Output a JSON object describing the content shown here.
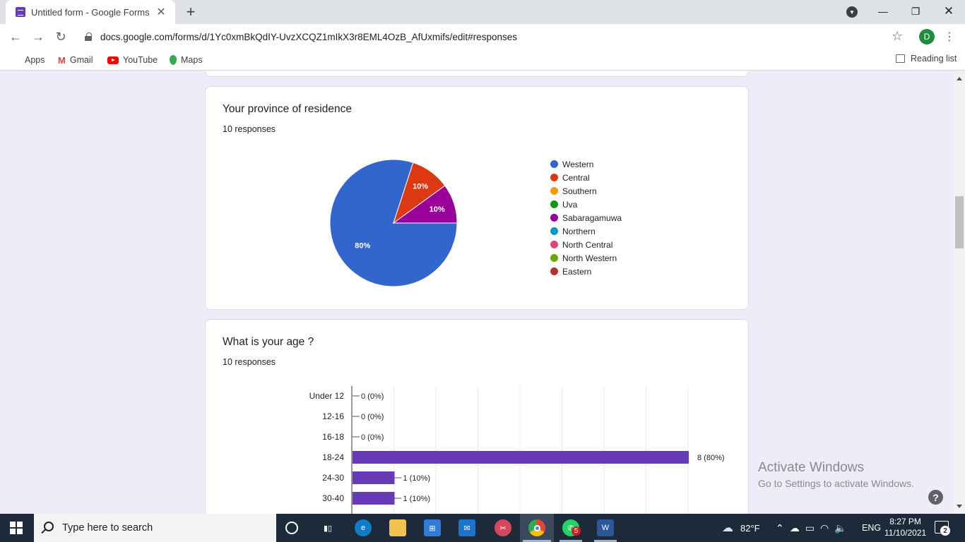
{
  "browser": {
    "tab_title": "Untitled form - Google Forms",
    "tab_close": "✕",
    "new_tab": "+",
    "url": "docs.google.com/forms/d/1Yc0xmBkQdIY-UvzXCQZ1mIkX3r8EML4OzB_AfUxmifs/edit#responses",
    "avatar_letter": "D",
    "bookmarks": [
      {
        "label": "Apps",
        "icon": "apps-grid-icon"
      },
      {
        "label": "Gmail",
        "icon": "gmail-icon"
      },
      {
        "label": "YouTube",
        "icon": "youtube-icon"
      },
      {
        "label": "Maps",
        "icon": "maps-icon"
      }
    ],
    "reading_list": "Reading list"
  },
  "questions": [
    {
      "title": "Your province of residence",
      "responses": "10 responses",
      "chart_data": {
        "type": "pie",
        "categories": [
          "Western",
          "Central",
          "Southern",
          "Uva",
          "Sabaragamuwa",
          "Northern",
          "North Central",
          "North Western",
          "Eastern"
        ],
        "values": [
          80,
          10,
          0,
          0,
          10,
          0,
          0,
          0,
          0
        ],
        "slice_labels": [
          "80%",
          "10%",
          "",
          "",
          "10%",
          "",
          "",
          "",
          ""
        ],
        "colors": [
          "#3366cc",
          "#dc3912",
          "#ff9900",
          "#109618",
          "#990099",
          "#0099c6",
          "#dd4477",
          "#66aa00",
          "#b82e2e"
        ],
        "legend_position": "right"
      }
    },
    {
      "title": "What is your age ?",
      "responses": "10 responses",
      "chart_data": {
        "type": "bar",
        "orientation": "horizontal",
        "categories": [
          "Under 12",
          "12-16",
          "16-18",
          "18-24",
          "24-30",
          "30-40"
        ],
        "values": [
          0,
          0,
          0,
          8,
          1,
          1
        ],
        "data_labels": [
          "0 (0%)",
          "0 (0%)",
          "0 (0%)",
          "8 (80%)",
          "1 (10%)",
          "1 (10%)"
        ],
        "xlim": [
          0,
          8
        ],
        "color": "#673ab7",
        "grid": true
      }
    }
  ],
  "overlay": {
    "activate_title": "Activate Windows",
    "activate_sub": "Go to Settings to activate Windows.",
    "help": "?"
  },
  "taskbar": {
    "search_placeholder": "Type here to search",
    "weather": "82°F",
    "language": "ENG",
    "time": "8:27 PM",
    "date": "11/10/2021",
    "notifications": "2",
    "whatsapp_badge": "5"
  }
}
